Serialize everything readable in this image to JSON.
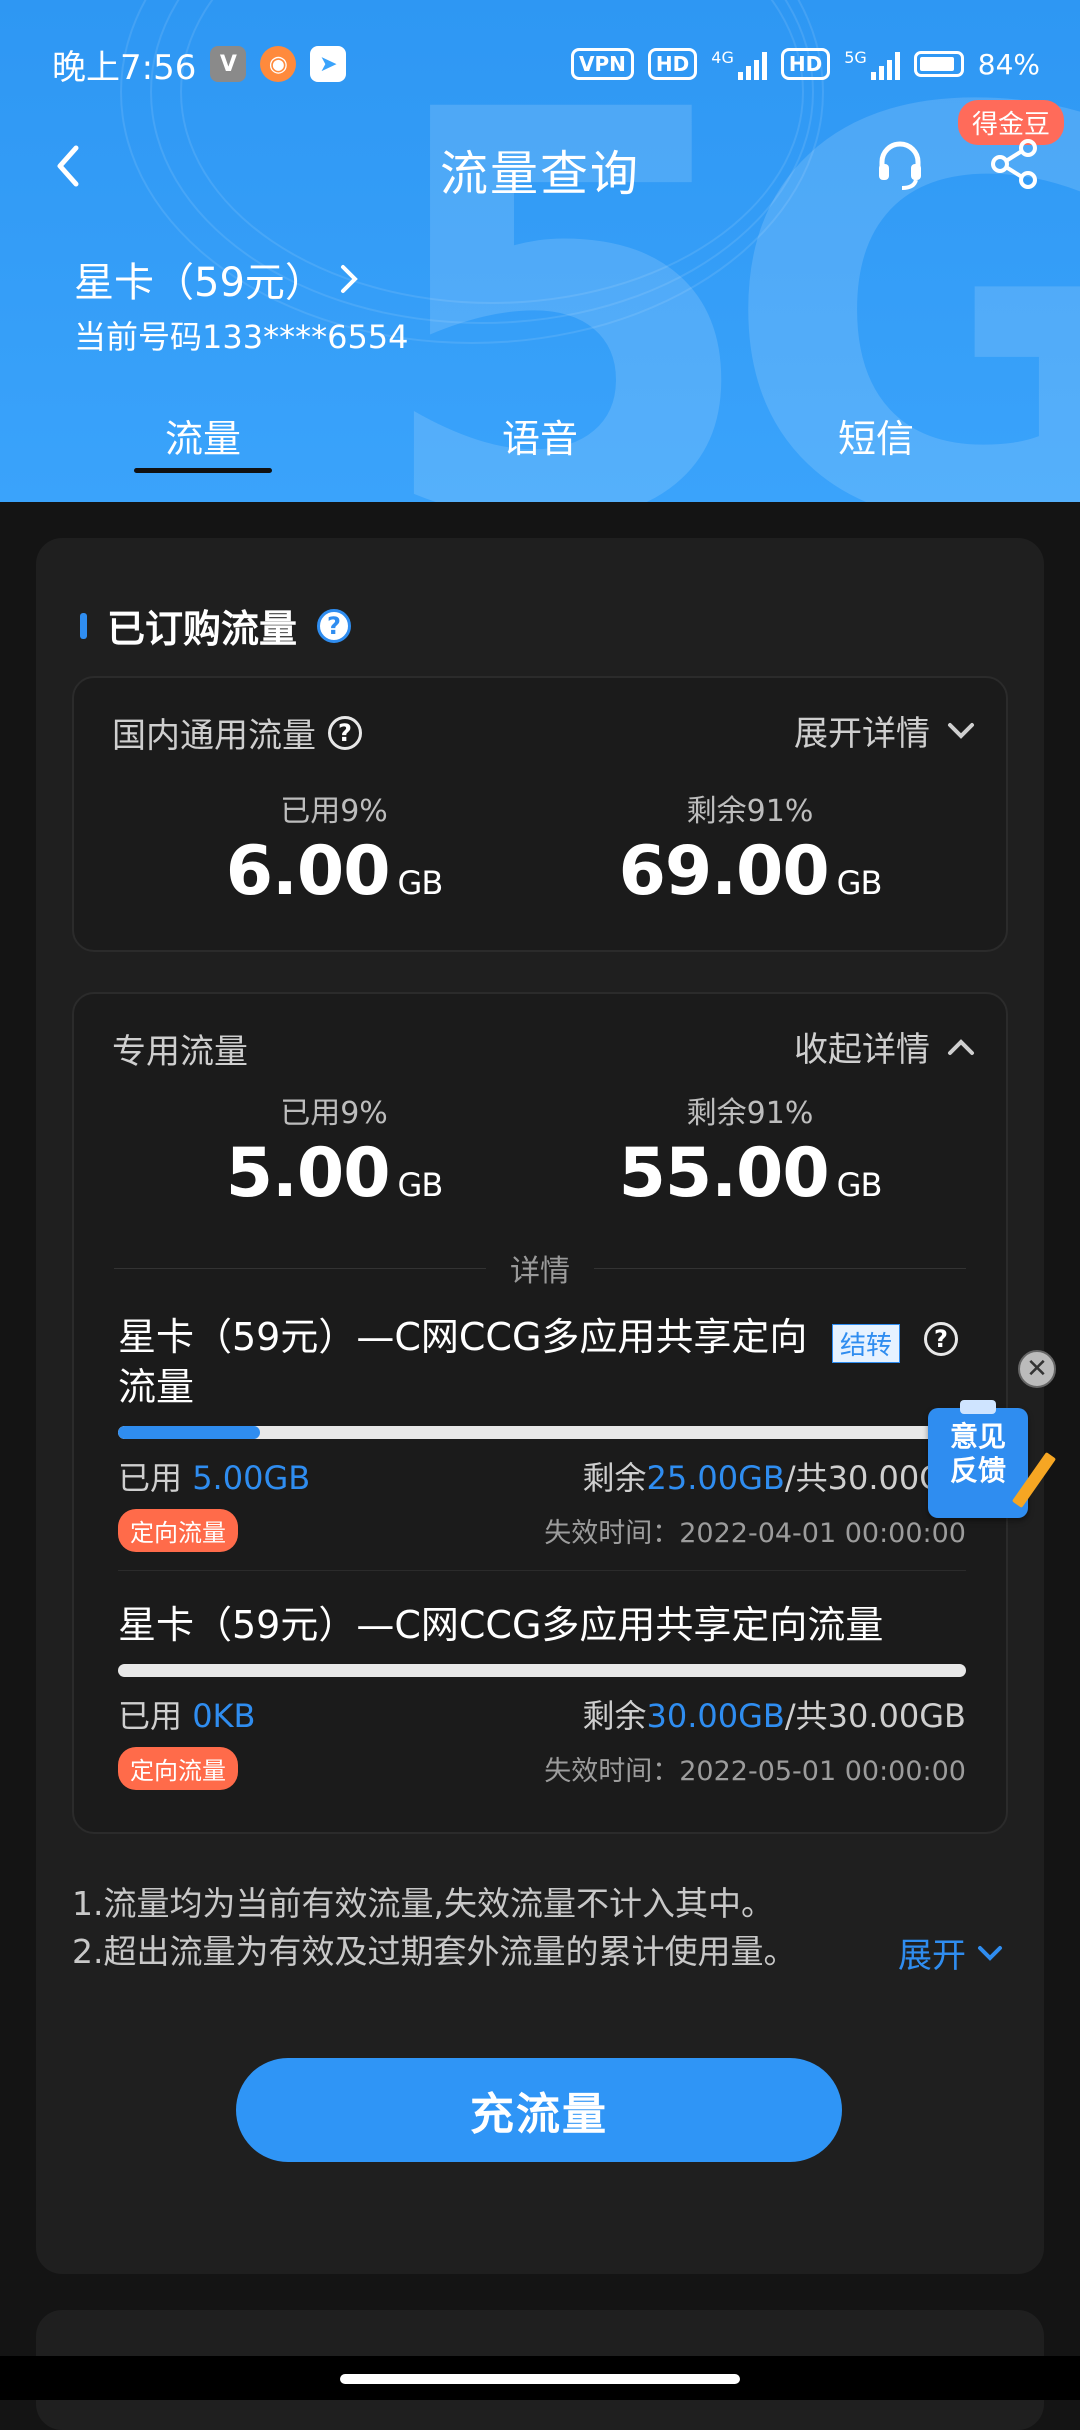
{
  "status_bar": {
    "time": "晚上7:56",
    "vpn": "VPN",
    "hd1": "HD",
    "net1": "4G",
    "hd2": "HD",
    "net2": "5G",
    "battery": "84%"
  },
  "header": {
    "title": "流量查询",
    "reward_badge": "得金豆",
    "plan_name": "星卡（59元）",
    "phone_label": "当前号码133****6554"
  },
  "tabs": [
    {
      "label": "流量"
    },
    {
      "label": "语音"
    },
    {
      "label": "短信"
    }
  ],
  "subscribed": {
    "heading": "已订购流量",
    "domestic": {
      "title": "国内通用流量",
      "toggle_label": "展开详情",
      "used_label": "已用9%",
      "used_value": "6.00",
      "used_unit": "GB",
      "remaining_label": "剩余91%",
      "remaining_value": "69.00",
      "remaining_unit": "GB"
    },
    "dedicated": {
      "title": "专用流量",
      "toggle_label": "收起详情",
      "used_label": "已用9%",
      "used_value": "5.00",
      "used_unit": "GB",
      "remaining_label": "剩余91%",
      "remaining_value": "55.00",
      "remaining_unit": "GB",
      "details_label": "详情",
      "items": [
        {
          "name": "星卡（59元）—C网CCG多应用共享定向流量",
          "transfer_tag": "结转",
          "progress": 0.167,
          "used_prefix": "已用",
          "used": "5.00GB",
          "remaining_prefix": "剩余",
          "remaining": "25.00GB",
          "total": "/共30.00GB",
          "tag": "定向流量",
          "expire": "失效时间：2022-04-01 00:00:00"
        },
        {
          "name": "星卡（59元）—C网CCG多应用共享定向流量",
          "progress": 0,
          "used_prefix": "已用",
          "used": "0KB",
          "remaining_prefix": "剩余",
          "remaining": "30.00GB",
          "total": "/共30.00GB",
          "tag": "定向流量",
          "expire": "失效时间：2022-05-01 00:00:00"
        }
      ]
    }
  },
  "notes": [
    "1.流量均为当前有效流量,失效流量不计入其中。",
    "2.超出流量为有效及过期套外流量的累计使用量。"
  ],
  "expand_link": "展开",
  "cta_label": "充流量",
  "feedback": {
    "line1": "意见",
    "line2": "反馈"
  },
  "colors": {
    "header_blue": "#3aa3fb",
    "accent": "#2f8df0",
    "tag_orange": "#ff6b4a",
    "badge_red": "#ff6b5a",
    "background": "#141414"
  }
}
